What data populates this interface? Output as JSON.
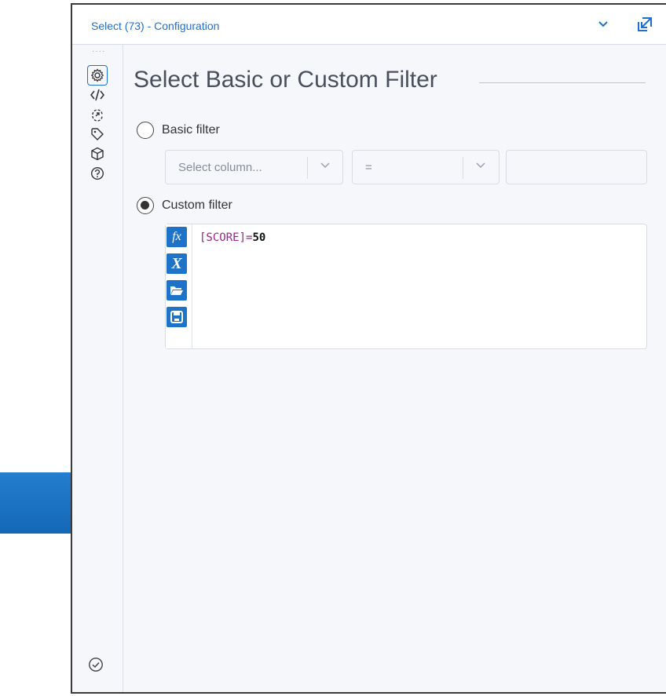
{
  "window": {
    "title": "Select (73) - Configuration"
  },
  "sidebar": {
    "items": [
      {
        "name": "configuration",
        "icon": "gear-icon",
        "active": true
      },
      {
        "name": "code",
        "icon": "code-icon",
        "active": false
      },
      {
        "name": "output",
        "icon": "output-icon",
        "active": false
      },
      {
        "name": "annotation",
        "icon": "tag-icon",
        "active": false
      },
      {
        "name": "metadata",
        "icon": "cube-icon",
        "active": false
      },
      {
        "name": "help",
        "icon": "help-icon",
        "active": false
      }
    ],
    "bottom_icon": "check-circle-icon"
  },
  "main": {
    "heading": "Select Basic or Custom Filter",
    "basic_filter": {
      "label": "Basic filter",
      "selected": false,
      "column_placeholder": "Select column...",
      "operator": "=",
      "value": ""
    },
    "custom_filter": {
      "label": "Custom filter",
      "selected": true,
      "expression": {
        "field": "[SCORE]",
        "operator": "=",
        "value": "50"
      },
      "toolbar": [
        {
          "icon": "function-icon",
          "glyph": "fx"
        },
        {
          "icon": "variable-icon",
          "glyph": "X"
        },
        {
          "icon": "open-folder-icon"
        },
        {
          "icon": "save-icon"
        }
      ]
    }
  },
  "colors": {
    "accent": "#1f6fd0",
    "arrow": "#1a6fc4",
    "code_field": "#a0238c"
  }
}
